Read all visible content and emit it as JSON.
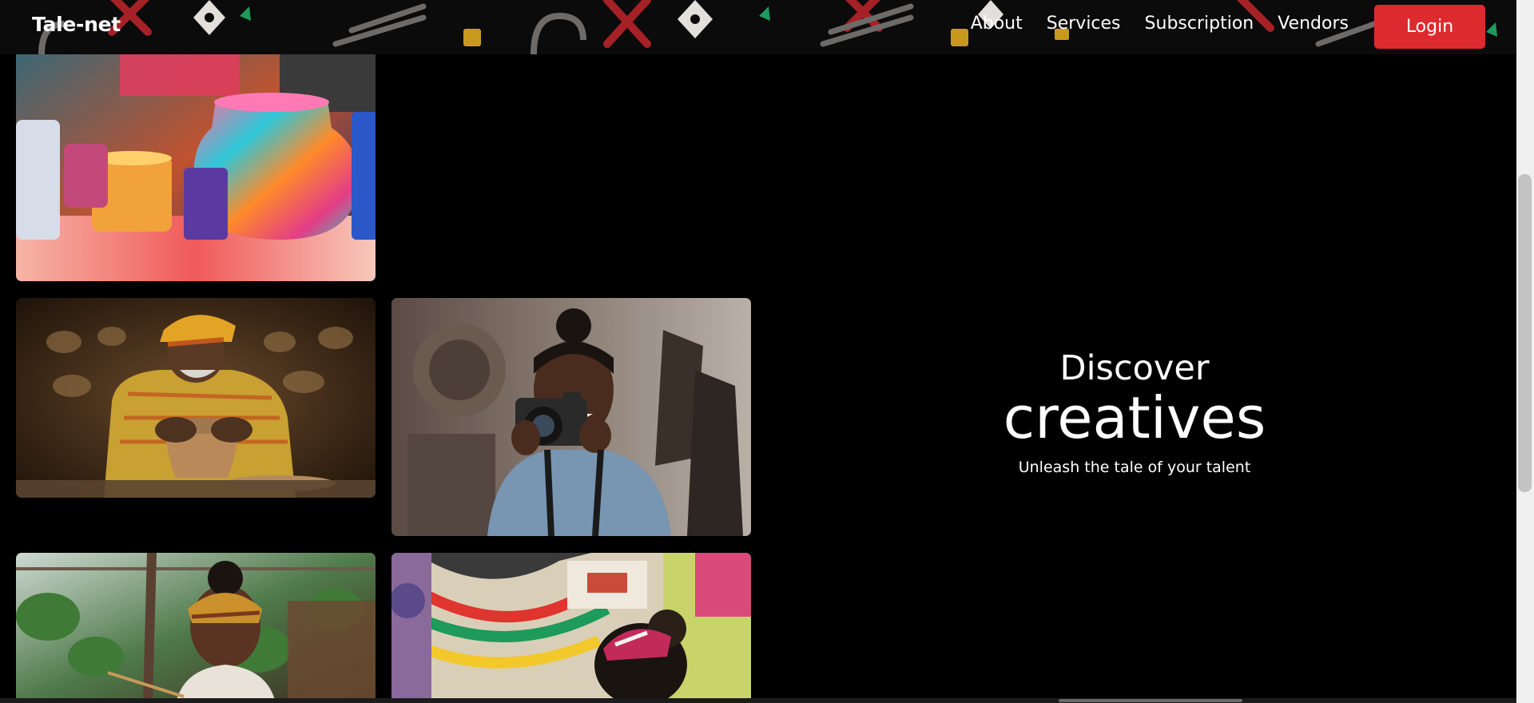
{
  "brand": {
    "name": "Tale-net"
  },
  "nav": {
    "links": [
      "About",
      "Services",
      "Subscription",
      "Vendors"
    ],
    "login_label": "Login"
  },
  "hero": {
    "line1": "Discover",
    "line2": "creatives",
    "tagline": "Unleash the tale of your talent"
  },
  "colors": {
    "background": "#000000",
    "accent": "#dc2a2f",
    "text": "#ffffff"
  },
  "gallery": [
    {
      "icon": "painted-pottery-photo"
    },
    {
      "icon": "potter-at-wheel-photo"
    },
    {
      "icon": "photographer-with-camera-photo"
    },
    {
      "icon": "woman-painting-photo"
    },
    {
      "icon": "woman-by-mural-photo"
    }
  ]
}
